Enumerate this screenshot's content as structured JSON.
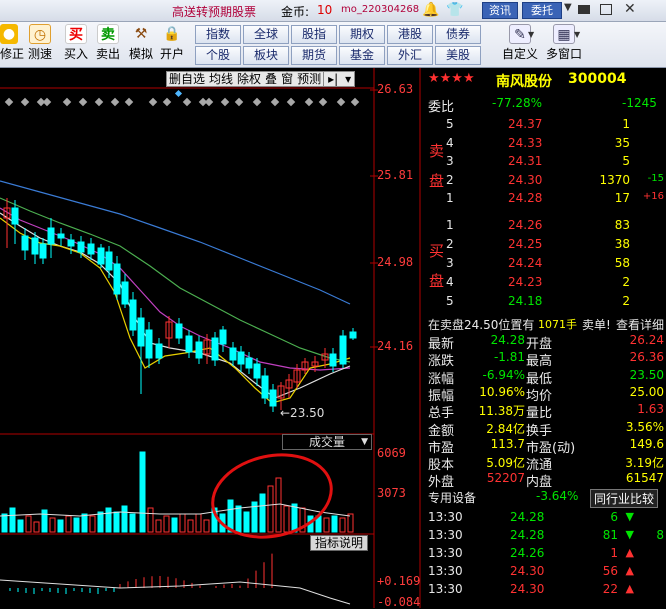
{
  "titlebar": {
    "promo": "高送转预期股票",
    "coins_label": "金币:",
    "coins_value": "10",
    "user": "mo_220304268",
    "news_btn": "资讯",
    "order_btn": "委托"
  },
  "toolbar": {
    "left_buttons": [
      "修正",
      "测速",
      "买入",
      "卖出",
      "模拟",
      "开户"
    ],
    "grid_row1": [
      "指数",
      "全球",
      "股指",
      "期权",
      "港股",
      "债券"
    ],
    "grid_row2": [
      "个股",
      "板块",
      "期货",
      "基金",
      "外汇",
      "美股"
    ],
    "right_buttons": [
      "自定义",
      "多窗口"
    ]
  },
  "chart_toolbar": [
    "删自选",
    "均线",
    "除权",
    "叠",
    "窗",
    "预测"
  ],
  "price_axis": [
    "26.63",
    "25.81",
    "24.98",
    "24.16"
  ],
  "low_marker": "←23.50",
  "volume_label": "成交量",
  "volume_axis": [
    "6069",
    "3073"
  ],
  "indicator_label": "指标说明",
  "indicator_axis": [
    "+0.169",
    "-0.084"
  ],
  "colors": {
    "up": "#ff3232",
    "down": "#00ffff",
    "bg": "#000000",
    "grid": "#a00000"
  },
  "stock": {
    "name": "南风股份",
    "code": "300004",
    "stars": "★★★★",
    "ratio_label": "委比",
    "ratio_value": "-77.28%",
    "ratio_diff": "-1245",
    "sell_label": [
      "卖",
      "盘"
    ],
    "buy_label": [
      "买",
      "盘"
    ],
    "sells": [
      {
        "n": "5",
        "price": "24.37",
        "vol": "1",
        "chg": ""
      },
      {
        "n": "4",
        "price": "24.33",
        "vol": "35",
        "chg": ""
      },
      {
        "n": "3",
        "price": "24.31",
        "vol": "5",
        "chg": ""
      },
      {
        "n": "2",
        "price": "24.30",
        "vol": "1370",
        "chg": "-15"
      },
      {
        "n": "1",
        "price": "24.28",
        "vol": "17",
        "chg": "+16"
      }
    ],
    "buys": [
      {
        "n": "1",
        "price": "24.26",
        "vol": "83"
      },
      {
        "n": "2",
        "price": "24.25",
        "vol": "38"
      },
      {
        "n": "3",
        "price": "24.24",
        "vol": "58"
      },
      {
        "n": "4",
        "price": "24.23",
        "vol": "2"
      },
      {
        "n": "5",
        "price": "24.18",
        "vol": "2"
      }
    ],
    "notice": "在卖盘24.50位置有",
    "notice_vol": "1071手",
    "notice_action": "卖单!",
    "notice_link": "查看详细",
    "quote": [
      {
        "l1": "最新",
        "v1": "24.28",
        "l2": "开盘",
        "v2": "26.24"
      },
      {
        "l1": "涨跌",
        "v1": "-1.81",
        "l2": "最高",
        "v2": "26.36"
      },
      {
        "l1": "涨幅",
        "v1": "-6.94%",
        "l2": "最低",
        "v2": "23.50"
      },
      {
        "l1": "振幅",
        "v1": "10.96%",
        "l2": "均价",
        "v2": "25.00"
      },
      {
        "l1": "总手",
        "v1": "11.38万",
        "l2": "量比",
        "v2": "1.63"
      },
      {
        "l1": "金额",
        "v1": "2.84亿",
        "l2": "换手",
        "v2": "3.56%"
      },
      {
        "l1": "市盈",
        "v1": "113.7",
        "l2": "市盈(动)",
        "v2": "149.6"
      },
      {
        "l1": "股本",
        "v1": "5.09亿",
        "l2": "流通",
        "v2": "3.19亿"
      },
      {
        "l1": "外盘",
        "v1": "52207",
        "l2": "内盘",
        "v2": "61547"
      }
    ],
    "sector": "专用设备",
    "sector_pct": "-3.64%",
    "peer_btn": "同行业比较",
    "ticks": [
      {
        "time": "13:30",
        "price": "24.28",
        "vol": "6",
        "dir": "down"
      },
      {
        "time": "13:30",
        "price": "24.28",
        "vol": "81",
        "dir": "down"
      },
      {
        "time": "13:30",
        "price": "24.26",
        "vol": "1",
        "dir": "up"
      },
      {
        "time": "13:30",
        "price": "24.30",
        "vol": "56",
        "dir": "up"
      },
      {
        "time": "13:30",
        "price": "24.30",
        "vol": "22",
        "dir": "up"
      }
    ],
    "tick_extra": [
      "",
      "8",
      "",
      "",
      ""
    ]
  },
  "chart_data": {
    "type": "candlestick",
    "y_axis_labels": [
      "26.63",
      "25.81",
      "24.98",
      "24.16"
    ],
    "low_label": "23.50",
    "volume_axis_labels": [
      "6069",
      "3073"
    ],
    "indicator_axis_labels": [
      "+0.169",
      "-0.084"
    ]
  }
}
